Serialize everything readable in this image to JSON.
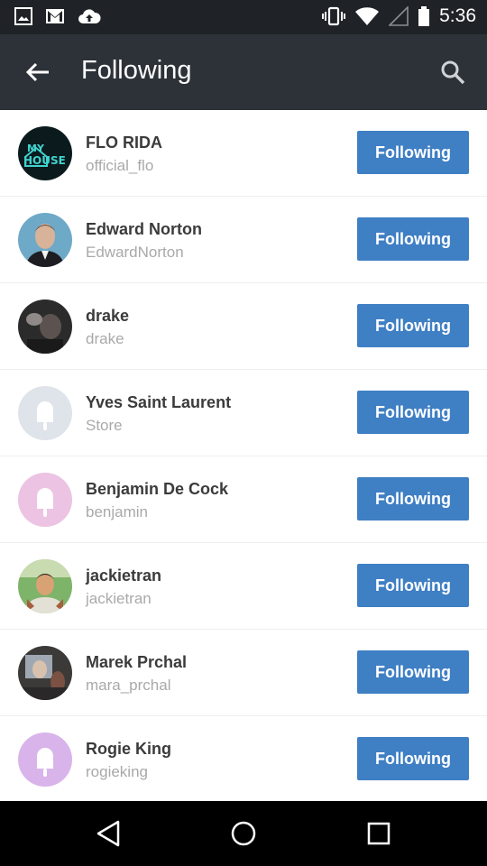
{
  "status_bar": {
    "time": "5:36",
    "left_icons": [
      "image-icon",
      "gmail-icon",
      "cloud-upload-icon"
    ],
    "right_icons": [
      "vibrate-icon",
      "wifi-icon",
      "signal-icon",
      "battery-icon"
    ]
  },
  "app_bar": {
    "title": "Following",
    "back_icon": "arrow-back-icon",
    "search_icon": "search-icon"
  },
  "users": [
    {
      "name": "FLO RIDA",
      "handle": "official_flo",
      "button": "Following",
      "avatar": "photo"
    },
    {
      "name": "Edward Norton",
      "handle": "EdwardNorton",
      "button": "Following",
      "avatar": "photo"
    },
    {
      "name": "drake",
      "handle": "drake",
      "button": "Following",
      "avatar": "photo"
    },
    {
      "name": "Yves Saint Laurent",
      "handle": "Store",
      "button": "Following",
      "avatar": "placeholder-gray"
    },
    {
      "name": "Benjamin De Cock",
      "handle": "benjamin",
      "button": "Following",
      "avatar": "placeholder-pink"
    },
    {
      "name": "jackietran",
      "handle": "jackietran",
      "button": "Following",
      "avatar": "photo"
    },
    {
      "name": "Marek Prchal",
      "handle": "mara_prchal",
      "button": "Following",
      "avatar": "photo"
    },
    {
      "name": "Rogie King",
      "handle": "rogieking",
      "button": "Following",
      "avatar": "placeholder-purple"
    }
  ],
  "colors": {
    "status_bar": "#1f2327",
    "app_bar": "#2d3238",
    "button": "#3f7fc4",
    "placeholder_gray": "#dfe3ea",
    "placeholder_pink": "#ecc3e2",
    "placeholder_purple": "#d9b4ea"
  },
  "nav_bar": {
    "back": "nav-back-icon",
    "home": "nav-home-icon",
    "recents": "nav-recents-icon"
  }
}
